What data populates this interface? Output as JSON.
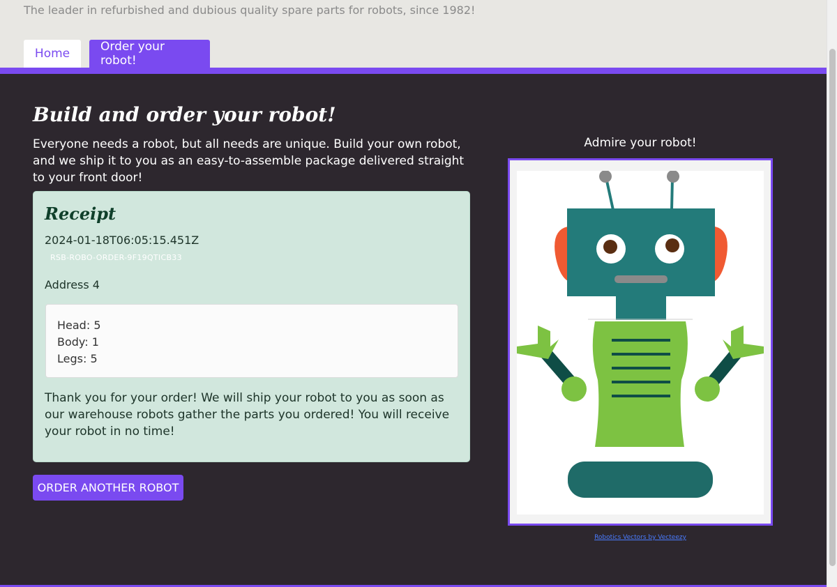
{
  "header": {
    "tagline": "The leader in refurbished and dubious quality spare parts for robots, since 1982!"
  },
  "nav": {
    "tabs": [
      {
        "label": "Home",
        "active": false
      },
      {
        "label": "Order your robot!",
        "active": true
      }
    ]
  },
  "main": {
    "title": "Build and order your robot!",
    "intro": "Everyone needs a robot, but all needs are unique. Build your own robot, and we ship it to you as an easy-to-assemble package delivered straight to your front door!",
    "receipt": {
      "title": "Receipt",
      "timestamp": "2024-01-18T06:05:15.451Z",
      "order_id": "RSB-ROBO-ORDER-9F19QTICB33",
      "address": "Address 4",
      "parts": {
        "head": "Head: 5",
        "body": "Body: 1",
        "legs": "Legs: 5"
      },
      "thanks": "Thank you for your order! We will ship your robot to you as soon as our warehouse robots gather the parts you ordered! You will receive your robot in no time!"
    },
    "order_another_label": "ORDER ANOTHER ROBOT",
    "preview": {
      "heading": "Admire your robot!",
      "image_alt": "robot-preview",
      "credit": "Robotics Vectors by Vecteezy"
    }
  },
  "colors": {
    "accent": "#7a4af0",
    "background_dark": "#2d272e",
    "receipt_bg": "#d1e7dd",
    "robot_teal": "#237b7a",
    "robot_green": "#7dc242",
    "robot_dark_teal": "#0f4d46",
    "robot_ear": "#f05a32"
  }
}
